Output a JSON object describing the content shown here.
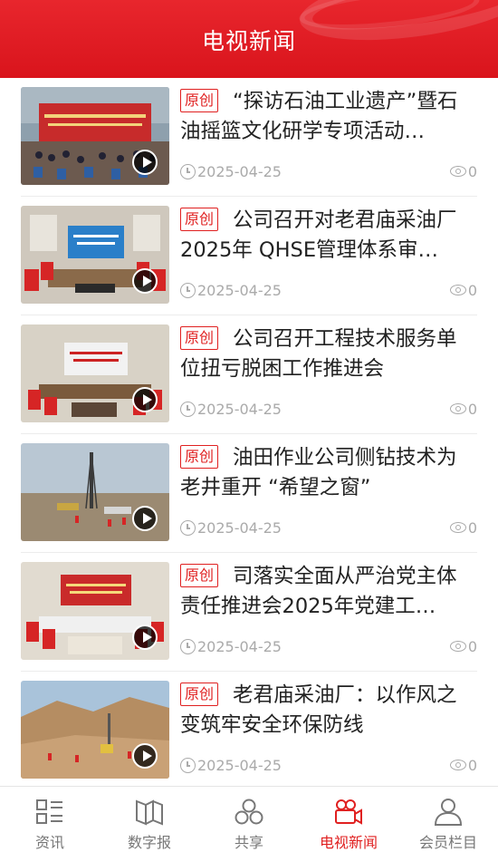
{
  "header": {
    "title": "电视新闻"
  },
  "badge_label": "原创",
  "accent_color": "#e02020",
  "news": [
    {
      "badge": "原创",
      "title": "“探访石油工业遗产”暨石油摇篮文化研学专项活动…",
      "date": "2025-04-25",
      "views": "0",
      "thumb_scene": "outdoor-ceremony"
    },
    {
      "badge": "原创",
      "title": "公司召开对老君庙采油厂2025年 QHSE管理体系审…",
      "date": "2025-04-25",
      "views": "0",
      "thumb_scene": "meeting-room"
    },
    {
      "badge": "原创",
      "title": "公司召开工程技术服务单位扭亏脱困工作推进会",
      "date": "2025-04-25",
      "views": "0",
      "thumb_scene": "meeting-room"
    },
    {
      "badge": "原创",
      "title": "油田作业公司侧钻技术为老井重开 “希望之窗”",
      "date": "2025-04-25",
      "views": "0",
      "thumb_scene": "desert-rig"
    },
    {
      "badge": "原创",
      "title": "司落实全面从严治党主体责任推进会2025年党建工…",
      "date": "2025-04-25",
      "views": "0",
      "thumb_scene": "meeting-room"
    },
    {
      "badge": "原创",
      "title": "老君庙采油厂：以作风之变筑牢安全环保防线",
      "date": "2025-04-25",
      "views": "0",
      "thumb_scene": "hill-site"
    }
  ],
  "tabbar": [
    {
      "label": "资讯",
      "icon": "list-icon",
      "active": false
    },
    {
      "label": "数字报",
      "icon": "newspaper-icon",
      "active": false
    },
    {
      "label": "共享",
      "icon": "share-circles-icon",
      "active": false
    },
    {
      "label": "电视新闻",
      "icon": "video-camera-icon",
      "active": true
    },
    {
      "label": "会员栏目",
      "icon": "user-icon",
      "active": false
    }
  ]
}
